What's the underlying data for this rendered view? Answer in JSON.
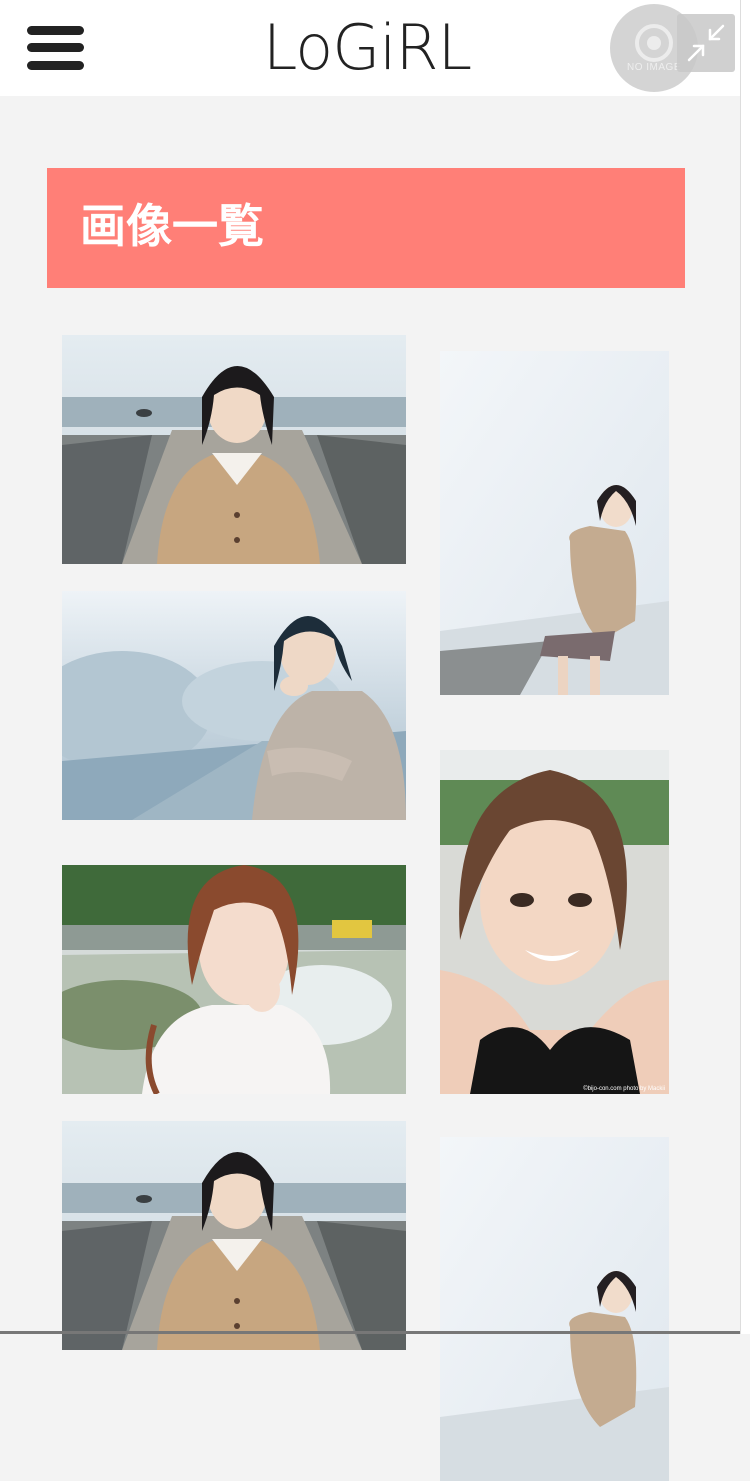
{
  "header": {
    "logo_text": "LoGiRL",
    "avatar_placeholder": "NO IMAGE",
    "icons": {
      "menu": "hamburger-icon",
      "avatar": "no-image-icon",
      "shrink": "shrink-arrows-icon"
    }
  },
  "page": {
    "title": "画像一覧"
  },
  "colors": {
    "accent": "#ff7f77",
    "background": "#f3f3f3",
    "header_bg": "#ffffff"
  },
  "gallery": {
    "images": [
      {
        "subject": "girl-beige-cardigan-pier-sea"
      },
      {
        "subject": "girl-leaning-on-wall-sky"
      },
      {
        "subject": "girl-sitting-hand-on-chin"
      },
      {
        "subject": "girl-smiling-close-up"
      },
      {
        "subject": "girl-fountain-park"
      },
      {
        "subject": "girl-beige-cardigan-pier-sea"
      },
      {
        "subject": "girl-leaning-on-wall-sky"
      }
    ]
  },
  "watermark": "©bijo-con.com photo by Mackii"
}
